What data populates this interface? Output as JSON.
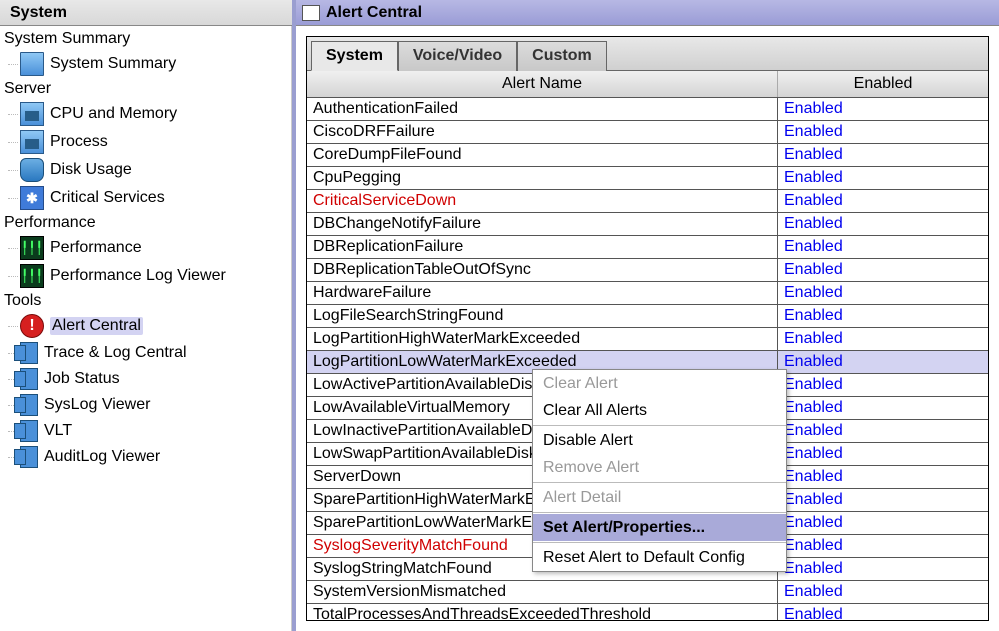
{
  "sidebar": {
    "title": "System",
    "groups": [
      {
        "label": "System Summary",
        "items": [
          {
            "label": "System Summary",
            "icon": "desktop"
          }
        ]
      },
      {
        "label": "Server",
        "items": [
          {
            "label": "CPU and Memory",
            "icon": "monitor"
          },
          {
            "label": "Process",
            "icon": "monitor"
          },
          {
            "label": "Disk Usage",
            "icon": "cylinder"
          },
          {
            "label": "Critical Services",
            "icon": "services"
          }
        ]
      },
      {
        "label": "Performance",
        "items": [
          {
            "label": "Performance",
            "icon": "perf"
          },
          {
            "label": "Performance Log Viewer",
            "icon": "perf"
          }
        ]
      },
      {
        "label": "Tools",
        "items": [
          {
            "label": "Alert Central",
            "icon": "alert",
            "selected": true
          },
          {
            "label": "Trace & Log Central",
            "icon": "docblue"
          },
          {
            "label": "Job Status",
            "icon": "docblue"
          },
          {
            "label": "SysLog Viewer",
            "icon": "docblue"
          },
          {
            "label": "VLT",
            "icon": "docblue"
          },
          {
            "label": "AuditLog Viewer",
            "icon": "docblue"
          }
        ]
      }
    ]
  },
  "main": {
    "title": "Alert Central",
    "tabs": [
      {
        "label": "System",
        "active": true
      },
      {
        "label": "Voice/Video",
        "active": false
      },
      {
        "label": "Custom",
        "active": false
      }
    ],
    "columns": {
      "name": "Alert Name",
      "enabled": "Enabled"
    },
    "rows": [
      {
        "name": "AuthenticationFailed",
        "enabled": "Enabled"
      },
      {
        "name": "CiscoDRFFailure",
        "enabled": "Enabled"
      },
      {
        "name": "CoreDumpFileFound",
        "enabled": "Enabled"
      },
      {
        "name": "CpuPegging",
        "enabled": "Enabled"
      },
      {
        "name": "CriticalServiceDown",
        "enabled": "Enabled",
        "critical": true
      },
      {
        "name": "DBChangeNotifyFailure",
        "enabled": "Enabled"
      },
      {
        "name": "DBReplicationFailure",
        "enabled": "Enabled"
      },
      {
        "name": "DBReplicationTableOutOfSync",
        "enabled": "Enabled"
      },
      {
        "name": "HardwareFailure",
        "enabled": "Enabled"
      },
      {
        "name": "LogFileSearchStringFound",
        "enabled": "Enabled"
      },
      {
        "name": "LogPartitionHighWaterMarkExceeded",
        "enabled": "Enabled"
      },
      {
        "name": "LogPartitionLowWaterMarkExceeded",
        "enabled": "Enabled",
        "selected": true
      },
      {
        "name": "LowActivePartitionAvailableDiskSpace",
        "enabled": "Enabled",
        "obscuredName": "LowActivePartitionAvailable",
        "obscuredEnabled": "nabled"
      },
      {
        "name": "LowAvailableVirtualMemory",
        "enabled": "Enabled",
        "obscuredName": "LowAvailableVirtualMemory",
        "obscuredEnabled": "nabled"
      },
      {
        "name": "LowInactivePartitionAvailableDiskSpace",
        "enabled": "Enabled",
        "obscuredName": "LowInactivePartitionAvailabl",
        "obscuredEnabled": "nabled"
      },
      {
        "name": "LowSwapPartitionAvailableDiskSpace",
        "enabled": "Enabled",
        "obscuredName": "LowSwapPartitionAvailableD",
        "obscuredEnabled": "nabled"
      },
      {
        "name": "ServerDown",
        "enabled": "Enabled",
        "obscuredName": "ServerDown",
        "obscuredEnabled": "nabled"
      },
      {
        "name": "SparePartitionHighWaterMarkExceeded",
        "enabled": "Enabled",
        "obscuredName": "SparePartitionHighWaterMa",
        "obscuredEnabled": "nabled"
      },
      {
        "name": "SparePartitionLowWaterMarkExceeded",
        "enabled": "Enabled",
        "obscuredName": "SparePartitionLowWaterMar",
        "obscuredEnabled": "nabled"
      },
      {
        "name": "SyslogSeverityMatchFound",
        "enabled": "Enabled",
        "critical": true,
        "obscuredName": "SyslogSeverityMatchFound",
        "obscuredEnabled": "nabled"
      },
      {
        "name": "SyslogStringMatchFound",
        "enabled": "Enabled"
      },
      {
        "name": "SystemVersionMismatched",
        "enabled": "Enabled"
      },
      {
        "name": "TotalProcessesAndThreadsExceededThreshold",
        "enabled": "Enabled"
      }
    ],
    "context_menu": [
      {
        "label": "Clear Alert",
        "disabled": true
      },
      {
        "label": "Clear All Alerts"
      },
      {
        "sep": true
      },
      {
        "label": "Disable Alert"
      },
      {
        "label": "Remove Alert",
        "disabled": true
      },
      {
        "sep": true
      },
      {
        "label": "Alert Detail",
        "disabled": true
      },
      {
        "sep": true
      },
      {
        "label": "Set Alert/Properties...",
        "highlight": true
      },
      {
        "sep": true
      },
      {
        "label": "Reset Alert to Default Config"
      }
    ]
  }
}
